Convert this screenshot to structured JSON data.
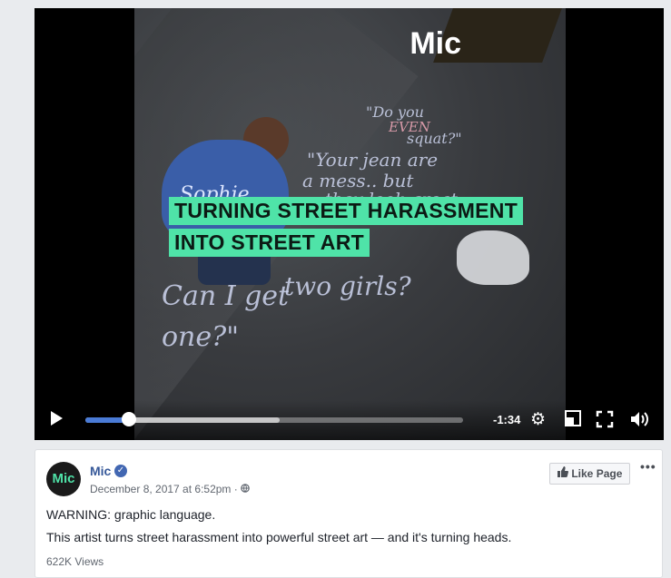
{
  "video": {
    "watermark": "Mic",
    "headline_line1": "TURNING STREET HARASSMENT",
    "headline_line2": "INTO STREET ART",
    "jacket_text": "Sophie",
    "chalk": {
      "c1": "\"Do you",
      "c2": "EVEN",
      "c3": "squat?\"",
      "c4": "\"Your jean are",
      "c5": "a mess.. but",
      "c6": "they look great",
      "c7": "two girls?",
      "c8": "Can I get",
      "c9": "one?\""
    },
    "time_remaining": "-1:34",
    "progress_played": 0.115,
    "progress_buffered": 0.515,
    "icons": {
      "play": "play-icon",
      "settings": "gear-icon",
      "pip": "picture-in-picture-icon",
      "fullscreen": "fullscreen-icon",
      "volume": "volume-icon"
    }
  },
  "post": {
    "page_name": "Mic",
    "avatar_text": "Mic",
    "timestamp": "December 8, 2017 at 6:52pm",
    "privacy_icon": "globe-icon",
    "like_page_label": "Like Page",
    "more_label": "•••",
    "line1": "WARNING: graphic language.",
    "line2": "This artist turns street harassment into powerful street art — and it's turning heads.",
    "views": "622K Views"
  },
  "colors": {
    "accent_green": "#4fe3a8",
    "link_blue": "#365899",
    "progress_blue": "#4a7bd6"
  }
}
